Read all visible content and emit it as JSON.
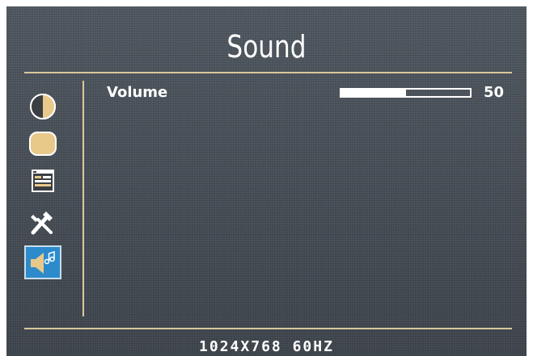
{
  "menu": {
    "title": "Sound",
    "resolution": "1024X768  60HZ"
  },
  "sidebar": {
    "items": [
      {
        "icon": "contrast-icon",
        "selected": false
      },
      {
        "icon": "screen-shape-icon",
        "selected": false
      },
      {
        "icon": "window-settings-icon",
        "selected": false
      },
      {
        "icon": "tools-icon",
        "selected": false
      },
      {
        "icon": "sound-icon",
        "selected": true
      }
    ]
  },
  "settings": {
    "volume": {
      "label": "Volume",
      "value": "50",
      "fraction": 0.5
    }
  },
  "colors": {
    "background": "#4a5159",
    "accent_line": "#d9c79b",
    "selection": "#2d8bcc",
    "text": "#ffffff",
    "icon_tan": "#e8c98a"
  }
}
